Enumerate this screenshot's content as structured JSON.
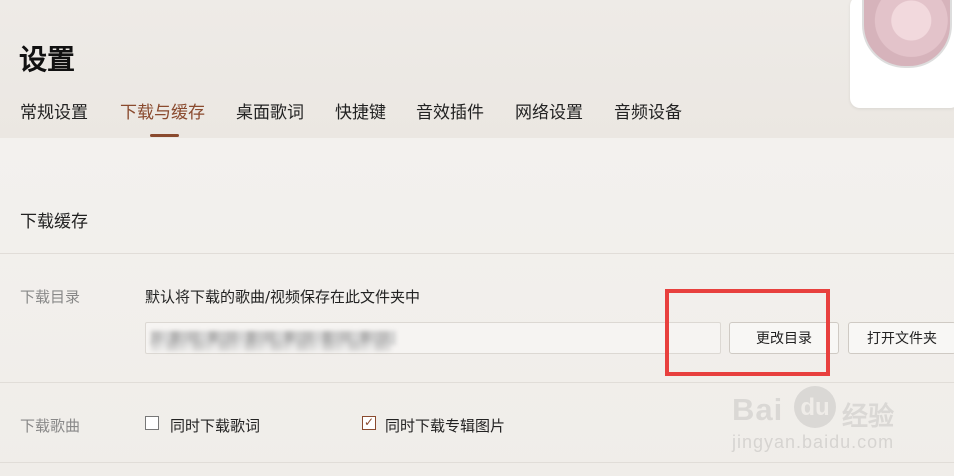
{
  "page": {
    "title": "设置"
  },
  "tabs": [
    {
      "label": "常规设置"
    },
    {
      "label": "下载与缓存",
      "active": true
    },
    {
      "label": "桌面歌词"
    },
    {
      "label": "快捷键"
    },
    {
      "label": "音效插件"
    },
    {
      "label": "网络设置"
    },
    {
      "label": "音频设备"
    }
  ],
  "section": {
    "title": "下载缓存"
  },
  "download_dir": {
    "label": "下载目录",
    "description": "默认将下载的歌曲/视频保存在此文件夹中",
    "change_button": "更改目录",
    "open_button": "打开文件夹"
  },
  "download_songs": {
    "label": "下载歌曲",
    "options": [
      {
        "label": "同时下载歌词",
        "checked": false
      },
      {
        "label": "同时下载专辑图片",
        "checked": true
      }
    ]
  },
  "watermark": {
    "brand": "Bai",
    "paw": "du",
    "cn": "经验",
    "url": "jingyan.baidu.com"
  },
  "colors": {
    "accent": "#8a4a2e",
    "highlight": "#e8403e"
  }
}
